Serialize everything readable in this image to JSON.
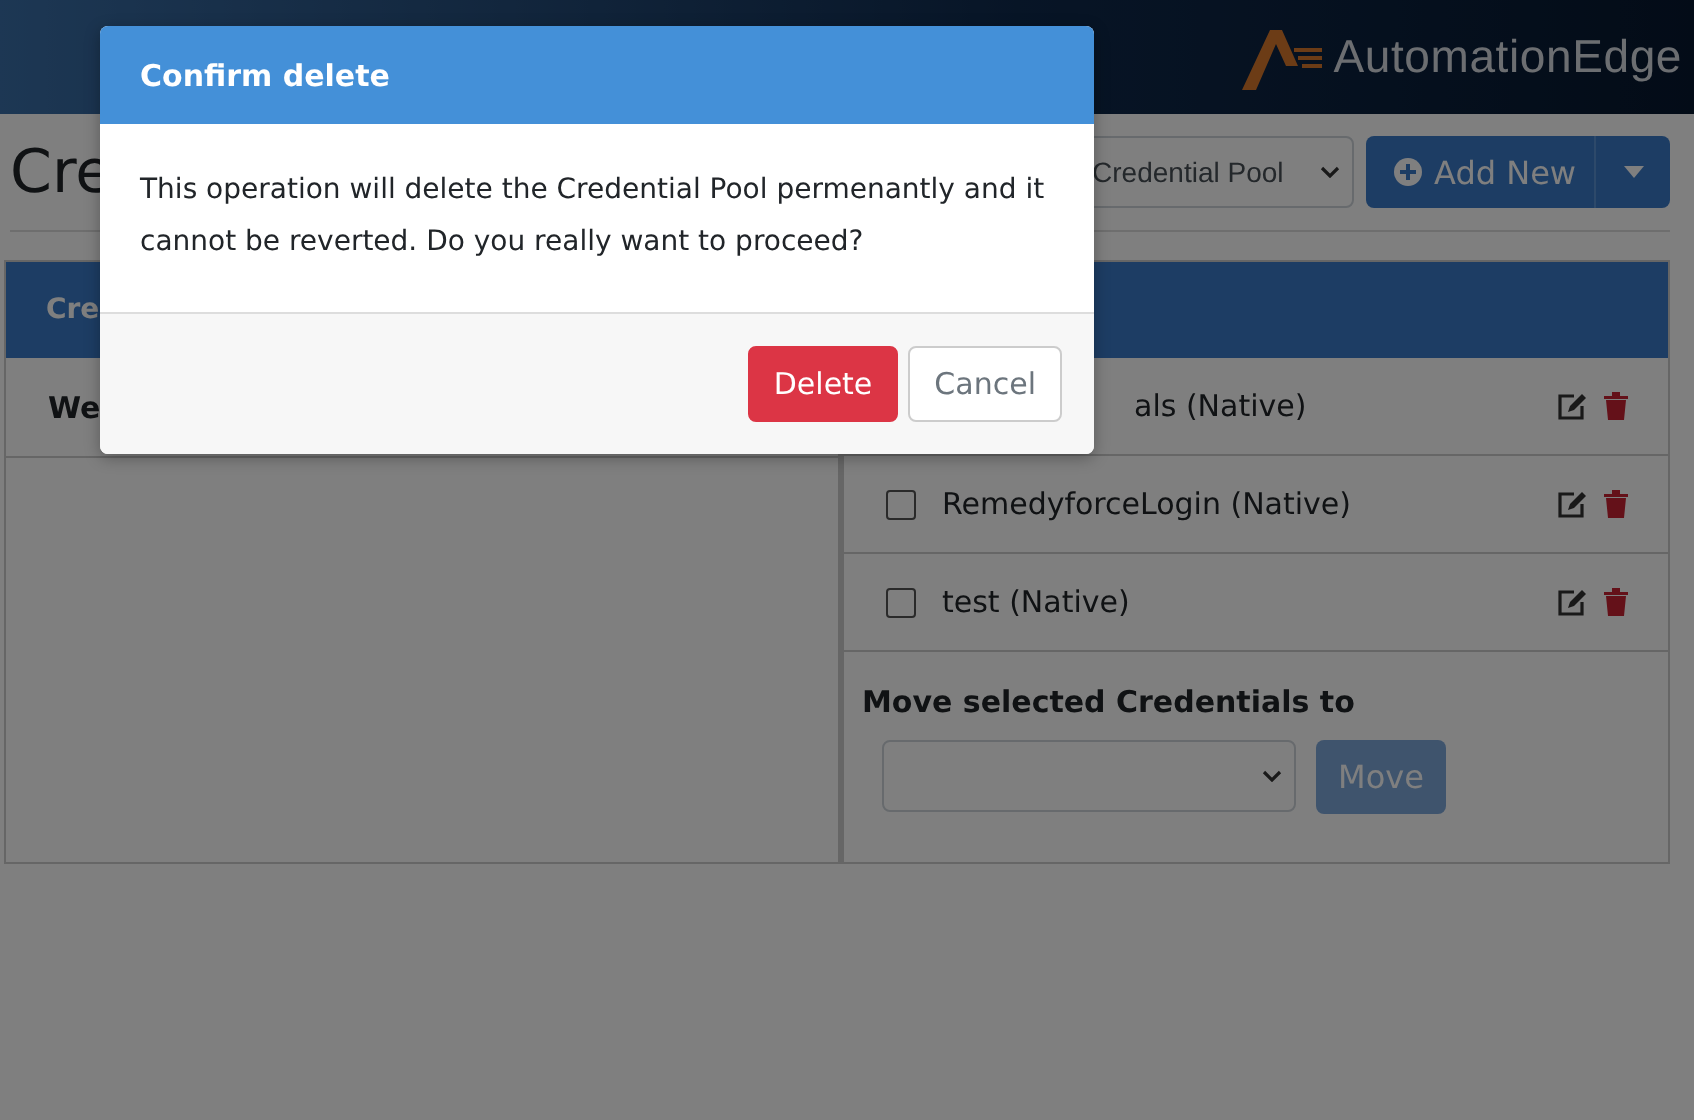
{
  "header": {
    "logo_text": "AutomationEdge"
  },
  "page": {
    "title": "Cre",
    "pool_select": {
      "value": "Credential Pool"
    },
    "add_button": {
      "label": "Add New"
    }
  },
  "left_panel": {
    "header": "Cre",
    "rows": [
      {
        "label": "We"
      }
    ]
  },
  "right_panel": {
    "rows": [
      {
        "label": "als (Native)"
      },
      {
        "label": "RemedyforceLogin (Native)",
        "checked": false
      },
      {
        "label": "test (Native)",
        "checked": false
      }
    ],
    "move_label": "Move selected Credentials to",
    "move_button": {
      "label": "Move",
      "disabled": true
    }
  },
  "dialog": {
    "title": "Confirm delete",
    "message": "This operation will delete the Credential Pool permenantly and it cannot be reverted. Do you really want to proceed?",
    "buttons": [
      {
        "label": "Delete",
        "kind": "danger"
      },
      {
        "label": "Cancel",
        "kind": "secondary"
      }
    ]
  }
}
